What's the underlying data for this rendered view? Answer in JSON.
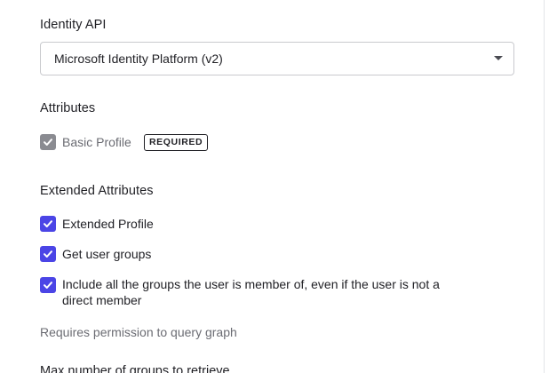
{
  "identity_api": {
    "label": "Identity API",
    "selected": "Microsoft Identity Platform (v2)"
  },
  "attributes": {
    "label": "Attributes",
    "basic_profile": {
      "label": "Basic Profile",
      "checked": true,
      "disabled": true,
      "badge": "REQUIRED"
    }
  },
  "extended_attributes": {
    "label": "Extended Attributes",
    "items": [
      {
        "label": "Extended Profile",
        "checked": true
      },
      {
        "label": "Get user groups",
        "checked": true
      },
      {
        "label_line1": "Include all the groups the user is member of, even if the user is not a",
        "label_line2": "direct member",
        "checked": true
      }
    ],
    "helper": "Requires permission to query graph"
  },
  "max_groups": {
    "label": "Max number of groups to retrieve"
  },
  "colors": {
    "accent": "#4b45e6",
    "disabled_check": "#8a8b91",
    "border": "#c9cace",
    "muted_text": "#6b6c73"
  }
}
